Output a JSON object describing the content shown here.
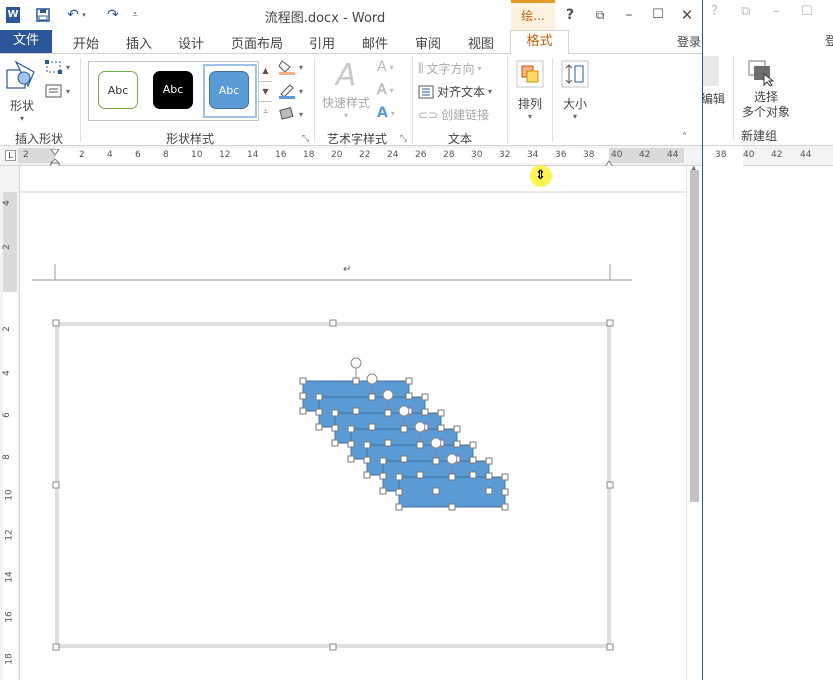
{
  "window": {
    "title": "流程图.docx - Word",
    "contextual_tab_group": "绘...",
    "help": "?",
    "login": "登录"
  },
  "tabs": {
    "file": "文件",
    "items": [
      "开始",
      "插入",
      "设计",
      "页面布局",
      "引用",
      "邮件",
      "审阅",
      "视图"
    ],
    "active": "格式"
  },
  "ribbon": {
    "insert_shapes": {
      "shapes_label": "形状",
      "group_label": "插入形状"
    },
    "shape_styles": {
      "gallery": [
        "Abc",
        "Abc",
        "Abc"
      ],
      "group_label": "形状样式"
    },
    "wordart": {
      "quick_styles": "快速样式",
      "group_label": "艺术字样式"
    },
    "text": {
      "direction": "文字方向",
      "align": "对齐文本",
      "link": "创建链接",
      "group_label": "文本"
    },
    "arrange": {
      "label": "排列"
    },
    "size": {
      "label": "大小"
    }
  },
  "background_window": {
    "help": "?",
    "login": "登",
    "edit_label": "编辑",
    "select_multi": "选择多个对象",
    "select_line1": "选择",
    "select_line2": "多个对象",
    "new_group": "新建组",
    "ruler_numbers": [
      "38",
      "40",
      "42",
      "44"
    ]
  },
  "ruler": {
    "numbers": [
      "2",
      "2",
      "4",
      "6",
      "8",
      "10",
      "12",
      "14",
      "16",
      "18",
      "20",
      "22",
      "24",
      "26",
      "28",
      "30",
      "32",
      "34",
      "36",
      "38",
      "40",
      "42",
      "44"
    ],
    "tab_stop": "L"
  },
  "vertical_ruler": {
    "numbers": [
      "4",
      "2",
      "2",
      "4",
      "6",
      "8",
      "10",
      "12",
      "14",
      "16",
      "18"
    ]
  },
  "document": {
    "paragraph_mark": "↵",
    "shape_color": "#5b9bd5"
  },
  "colors": {
    "accent": "#2b579a",
    "contextual": "#c85d00",
    "shape_fill": "#5b9bd5"
  }
}
